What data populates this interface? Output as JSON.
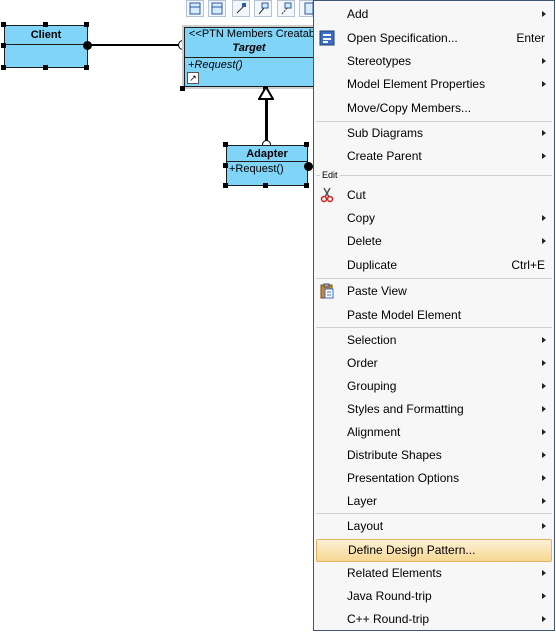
{
  "diagram": {
    "client": {
      "name": "Client"
    },
    "target": {
      "stereotype": "<<PTN Members Creatab",
      "name": "Target",
      "operation": "+Request()"
    },
    "adapter": {
      "name": "Adapter",
      "operation": "+Request()"
    },
    "toolbar_icons": [
      "class-icon",
      "class-icon",
      "association-icon",
      "generalization-icon",
      "dependency-icon",
      "realization-icon"
    ]
  },
  "menu": {
    "items": [
      {
        "label": "Add",
        "submenu": true
      },
      {
        "label": "Open Specification...",
        "shortcut": "Enter",
        "icon": "specification-icon"
      },
      {
        "label": "Stereotypes",
        "submenu": true
      },
      {
        "label": "Model Element Properties",
        "submenu": true
      },
      {
        "label": "Move/Copy Members..."
      },
      {
        "label": "Sub Diagrams",
        "submenu": true
      },
      {
        "label": "Create Parent",
        "submenu": true
      },
      {
        "label": "Cut",
        "icon": "scissors-icon"
      },
      {
        "label": "Copy",
        "submenu": true
      },
      {
        "label": "Delete",
        "submenu": true
      },
      {
        "label": "Duplicate",
        "shortcut": "Ctrl+E"
      },
      {
        "label": "Paste View",
        "icon": "clipboard-icon"
      },
      {
        "label": "Paste Model Element"
      },
      {
        "label": "Selection",
        "submenu": true
      },
      {
        "label": "Order",
        "submenu": true
      },
      {
        "label": "Grouping",
        "submenu": true
      },
      {
        "label": "Styles and Formatting",
        "submenu": true
      },
      {
        "label": "Alignment",
        "submenu": true
      },
      {
        "label": "Distribute Shapes",
        "submenu": true
      },
      {
        "label": "Presentation Options",
        "submenu": true
      },
      {
        "label": "Layer",
        "submenu": true
      },
      {
        "label": "Layout",
        "submenu": true
      },
      {
        "label": "Define Design Pattern...",
        "highlighted": true
      },
      {
        "label": "Related Elements",
        "submenu": true
      },
      {
        "label": "Java Round-trip",
        "submenu": true
      },
      {
        "label": "C++ Round-trip",
        "submenu": true
      }
    ],
    "edit_group_label": "Edit"
  },
  "colors": {
    "class_fill": "#80d4f8",
    "menu_background": "#f7f7f7",
    "menu_border": "#3c5674",
    "highlight_fill": "#f7d793",
    "highlight_border": "#e2b45e"
  }
}
